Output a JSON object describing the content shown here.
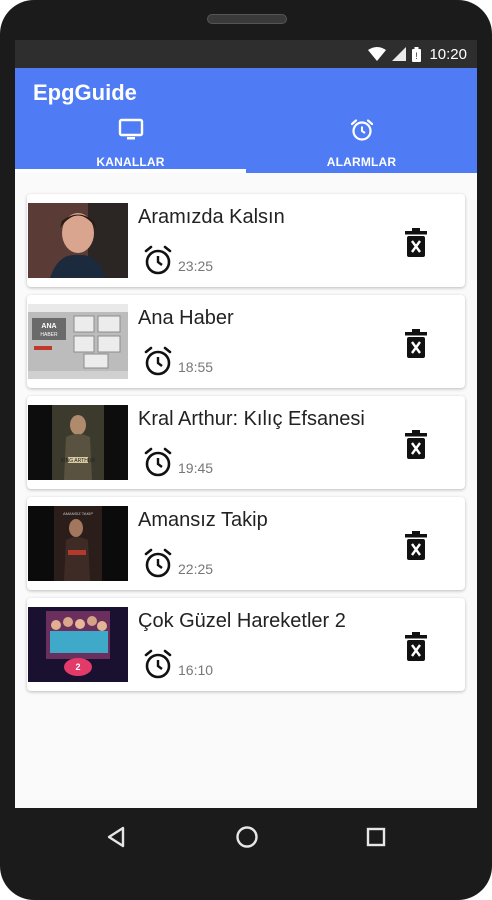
{
  "status_bar": {
    "time": "10:20",
    "icons": [
      "wifi-icon",
      "signal-icon",
      "battery-icon"
    ]
  },
  "app": {
    "title": "EpgGuide",
    "accent_color": "#4f7cf4"
  },
  "tabs": [
    {
      "label": "KANALLAR",
      "icon": "tv-icon",
      "selected": true
    },
    {
      "label": "ALARMLAR",
      "icon": "alarm-icon",
      "selected": false
    }
  ],
  "alarms": [
    {
      "title": "Aramızda Kalsın",
      "time": "23:25"
    },
    {
      "title": "Ana Haber",
      "time": "18:55"
    },
    {
      "title": "Kral Arthur: Kılıç Efsanesi",
      "time": "19:45"
    },
    {
      "title": "Amansız Takip",
      "time": "22:25"
    },
    {
      "title": "Çok Güzel Hareketler 2",
      "time": "16:10"
    }
  ],
  "nav": {
    "icons": [
      "back-icon",
      "home-icon",
      "recents-icon"
    ]
  }
}
